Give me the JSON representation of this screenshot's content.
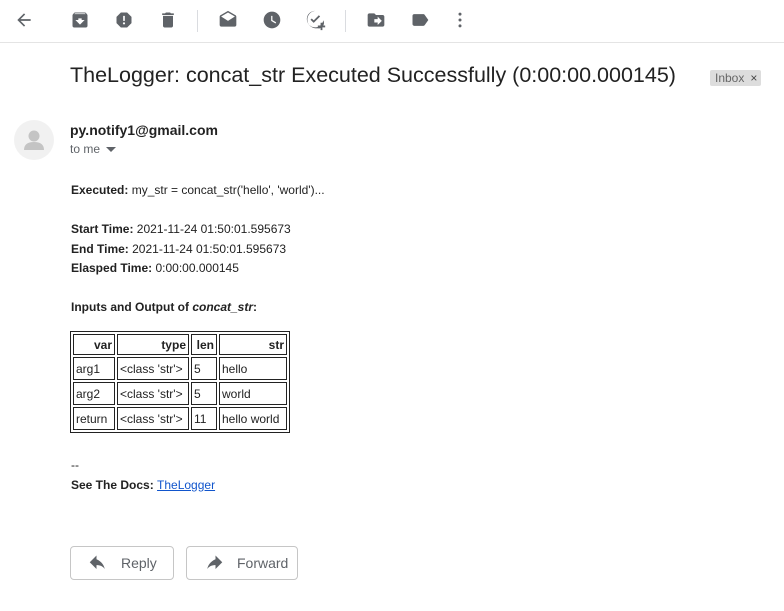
{
  "toolbar": {
    "icons": [
      "back-arrow-icon",
      "archive-icon",
      "report-spam-icon",
      "delete-icon",
      "mark-unread-icon",
      "snooze-icon",
      "add-to-tasks-icon",
      "move-to-icon",
      "labels-icon",
      "more-vert-icon"
    ]
  },
  "email": {
    "subject": "TheLogger: concat_str Executed Successfully (0:00:00.000145)",
    "label": "Inbox",
    "label_close": "×",
    "sender": "py.notify1@gmail.com",
    "to": "to me",
    "executed_label": "Executed:",
    "executed_value": " my_str = concat_str('hello', 'world')...",
    "start_label": "Start Time:",
    "start_value": " 2021-11-24 01:50:01.595673",
    "end_label": "End Time:",
    "end_value": " 2021-11-24 01:50:01.595673",
    "elapsed_label": "Elasped Time:",
    "elapsed_value": " 0:00:00.000145",
    "io_heading": "Inputs and Output of ",
    "io_func": "concat_str",
    "io_colon": ":",
    "table": {
      "headers": [
        "var",
        "type",
        "len",
        "str"
      ],
      "rows": [
        [
          "arg1",
          "<class 'str'>",
          "5",
          "hello"
        ],
        [
          "arg2",
          "<class 'str'>",
          "5",
          "world"
        ],
        [
          "return",
          "<class 'str'>",
          "11",
          "hello world"
        ]
      ]
    },
    "signature_sep": "--",
    "docs_label": "See The Docs: ",
    "docs_link": "TheLogger"
  },
  "actions": {
    "reply": "Reply",
    "forward": "Forward"
  },
  "colors": {
    "icon": "#5f6368",
    "link": "#1155cc",
    "badge_bg": "#dddddd"
  }
}
